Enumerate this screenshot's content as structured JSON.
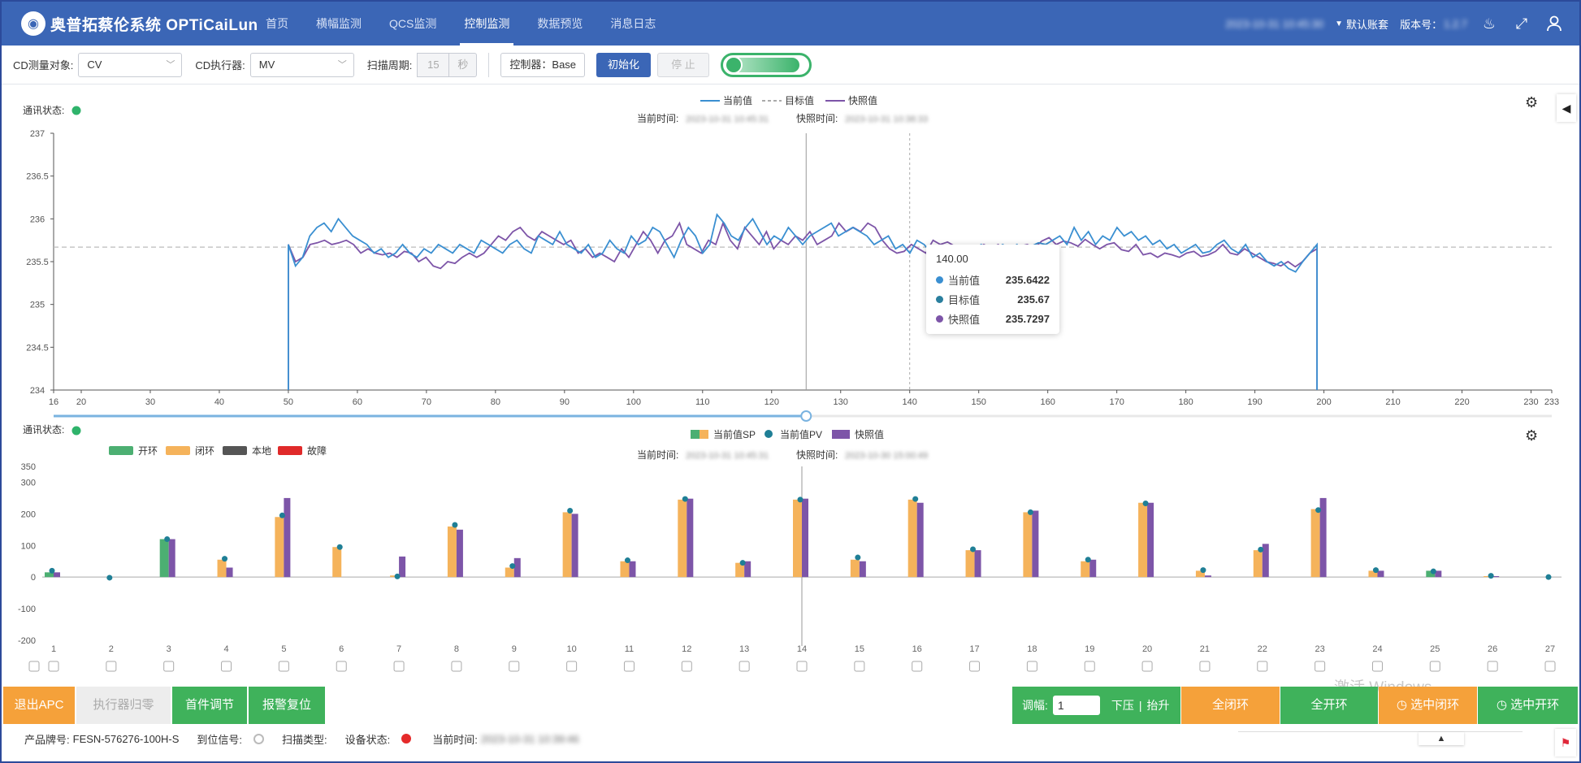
{
  "app": {
    "title": "奥普拓蔡伦系统 OPTiCaiLun",
    "nav": [
      "首页",
      "横幅监测",
      "QCS监测",
      "控制监测",
      "数据预览",
      "消息日志"
    ],
    "active_tab": "控制监测",
    "datetime": "2023-10-31 10:45:30",
    "account": "默认账套",
    "version_label": "版本号：",
    "version": "1.2.7"
  },
  "toolbar": {
    "cd_target_label": "CD测量对象:",
    "cd_target_value": "CV",
    "cd_actuator_label": "CD执行器:",
    "cd_actuator_value": "MV",
    "scan_period_label": "扫描周期:",
    "scan_period_value": "15",
    "scan_period_unit": "秒",
    "controller_text": "控制器：Base",
    "init_button": "初始化",
    "stop_button": "停 止"
  },
  "chart_top": {
    "comm_label": "通讯状态:",
    "comm_color": "#2fb36b",
    "legend": [
      "当前值",
      "目标值",
      "快照值"
    ],
    "current_time_label": "当前时间:",
    "current_time": "2023-10-31 10:45:31",
    "snapshot_time_label": "快照时间:",
    "snapshot_time": "2023-10-31 10:38:33",
    "tooltip": {
      "title": "140.00",
      "rows": [
        {
          "name": "当前值",
          "value": "235.6422",
          "color": "#3a8fd1"
        },
        {
          "name": "目标值",
          "value": "235.67",
          "color": "#2a7f9e"
        },
        {
          "name": "快照值",
          "value": "235.7297",
          "color": "#7d55a8"
        }
      ]
    }
  },
  "chart_bottom": {
    "comm_label": "通讯状态:",
    "status_legend": [
      {
        "name": "开环",
        "color": "#4caf72"
      },
      {
        "name": "闭环",
        "color": "#f5b35b"
      },
      {
        "name": "本地",
        "color": "#555555"
      },
      {
        "name": "故障",
        "color": "#e02a2a"
      }
    ],
    "legend": [
      "当前值SP",
      "当前值PV",
      "快照值"
    ],
    "current_time_label": "当前时间:",
    "current_time": "2023-10-31 10:45:31",
    "snapshot_time_label": "快照时间:",
    "snapshot_time": "2023-10-30 15:00:49"
  },
  "chart_data": [
    {
      "type": "line",
      "xlim": [
        16,
        233
      ],
      "x_ticks": [
        16,
        20,
        30,
        40,
        50,
        60,
        70,
        80,
        90,
        100,
        110,
        120,
        130,
        140,
        150,
        160,
        170,
        180,
        190,
        200,
        210,
        220,
        230,
        233
      ],
      "ylim": [
        234,
        237
      ],
      "y_ticks": [
        "234",
        "234.5",
        "235",
        "235.5",
        "236",
        "236.5",
        "237"
      ],
      "grid": false,
      "legend_position": "top-center",
      "target": 235.67,
      "cursor_x": 125,
      "snapshot_cursor_x": 140,
      "series": [
        {
          "name": "当前值",
          "color": "#3a8fd1",
          "x_start": 50,
          "x_end": 199,
          "values": [
            235.7,
            235.45,
            235.55,
            235.8,
            235.9,
            235.95,
            235.85,
            236.0,
            235.9,
            235.8,
            235.75,
            235.7,
            235.6,
            235.65,
            235.55,
            235.6,
            235.7,
            235.6,
            235.55,
            235.65,
            235.6,
            235.7,
            235.65,
            235.6,
            235.7,
            235.65,
            235.6,
            235.75,
            235.7,
            235.65,
            235.6,
            235.7,
            235.75,
            235.65,
            235.6,
            235.8,
            235.75,
            235.7,
            235.85,
            235.7,
            235.65,
            235.6,
            235.7,
            235.55,
            235.6,
            235.75,
            235.65,
            235.6,
            235.8,
            235.7,
            235.75,
            235.9,
            235.85,
            235.7,
            235.55,
            235.75,
            235.9,
            235.8,
            235.6,
            235.7,
            236.05,
            235.95,
            235.8,
            235.75,
            235.9,
            236.0,
            235.85,
            235.7,
            235.8,
            235.75,
            235.9,
            235.8,
            235.7,
            235.8,
            235.85,
            235.9,
            235.95,
            235.8,
            235.85,
            235.9,
            235.85,
            235.8,
            235.7,
            235.75,
            235.8,
            235.65,
            235.7,
            235.6,
            235.75,
            235.7,
            235.6,
            235.65,
            235.64,
            235.6,
            235.58,
            235.62,
            235.65,
            235.7,
            235.6,
            235.65,
            235.7,
            235.65,
            235.7,
            235.6,
            235.68,
            235.72,
            235.7,
            235.75,
            235.8,
            235.7,
            235.9,
            235.75,
            235.85,
            235.7,
            235.8,
            235.75,
            235.9,
            235.8,
            235.85,
            235.75,
            235.8,
            235.7,
            235.75,
            235.65,
            235.7,
            235.6,
            235.65,
            235.7,
            235.6,
            235.62,
            235.7,
            235.75,
            235.65,
            235.6,
            235.7,
            235.55,
            235.6,
            235.5,
            235.45,
            235.5,
            235.42,
            235.38,
            235.5,
            235.6,
            235.7
          ]
        },
        {
          "name": "快照值",
          "color": "#7d55a8",
          "x_start": 50,
          "x_end": 199,
          "values": [
            235.7,
            235.5,
            235.55,
            235.7,
            235.72,
            235.75,
            235.7,
            235.72,
            235.75,
            235.7,
            235.6,
            235.65,
            235.6,
            235.58,
            235.6,
            235.55,
            235.62,
            235.6,
            235.5,
            235.55,
            235.45,
            235.42,
            235.5,
            235.48,
            235.55,
            235.6,
            235.55,
            235.6,
            235.7,
            235.8,
            235.75,
            235.85,
            235.9,
            235.8,
            235.75,
            235.85,
            235.8,
            235.75,
            235.7,
            235.75,
            235.6,
            235.65,
            235.55,
            235.6,
            235.55,
            235.5,
            235.65,
            235.55,
            235.7,
            235.85,
            235.75,
            235.6,
            235.75,
            235.8,
            235.95,
            235.7,
            235.65,
            235.6,
            235.75,
            235.7,
            235.95,
            235.75,
            235.65,
            235.9,
            235.8,
            235.7,
            235.85,
            235.65,
            235.75,
            235.7,
            235.8,
            235.75,
            235.85,
            235.7,
            235.75,
            235.8,
            235.95,
            235.85,
            235.9,
            235.85,
            235.95,
            235.9,
            235.75,
            235.65,
            235.6,
            235.62,
            235.7,
            235.65,
            235.6,
            235.75,
            235.7,
            235.73,
            235.68,
            235.6,
            235.55,
            235.65,
            235.7,
            235.66,
            235.7,
            235.62,
            235.64,
            235.68,
            235.7,
            235.66,
            235.74,
            235.78,
            235.7,
            235.74,
            235.72,
            235.68,
            235.76,
            235.7,
            235.65,
            235.7,
            235.72,
            235.64,
            235.62,
            235.7,
            235.58,
            235.6,
            235.55,
            235.6,
            235.58,
            235.55,
            235.6,
            235.62,
            235.56,
            235.58,
            235.62,
            235.7,
            235.6,
            235.58,
            235.65,
            235.6,
            235.55,
            235.5,
            235.48,
            235.45,
            235.5,
            235.44,
            235.5,
            235.6,
            235.65
          ]
        }
      ]
    },
    {
      "type": "bar",
      "categories": [
        "1",
        "2",
        "3",
        "4",
        "5",
        "6",
        "7",
        "8",
        "9",
        "10",
        "11",
        "12",
        "13",
        "14",
        "15",
        "16",
        "17",
        "18",
        "19",
        "20",
        "21",
        "22",
        "23",
        "24",
        "25",
        "26",
        "27"
      ],
      "ylim": [
        -200,
        350
      ],
      "y_ticks": [
        "-200",
        "-100",
        "0",
        "100",
        "200",
        "300",
        "350"
      ],
      "cursor_category": "14",
      "series": [
        {
          "name": "当前值SP",
          "values": [
            15,
            0,
            120,
            55,
            190,
            95,
            5,
            160,
            30,
            205,
            50,
            245,
            45,
            245,
            55,
            245,
            85,
            205,
            50,
            235,
            20,
            85,
            215,
            20,
            20,
            3,
            0
          ],
          "status": [
            "开环",
            "闭环",
            "开环",
            "闭环",
            "闭环",
            "闭环",
            "闭环",
            "闭环",
            "闭环",
            "闭环",
            "闭环",
            "闭环",
            "闭环",
            "闭环",
            "闭环",
            "闭环",
            "闭环",
            "闭环",
            "闭环",
            "闭环",
            "闭环",
            "闭环",
            "闭环",
            "闭环",
            "开环",
            "闭环",
            "闭环"
          ]
        },
        {
          "name": "当前值PV",
          "values": [
            20,
            -2,
            120,
            58,
            195,
            95,
            2,
            165,
            35,
            210,
            53,
            247,
            45,
            245,
            62,
            247,
            88,
            205,
            55,
            233,
            22,
            87,
            212,
            22,
            18,
            4,
            0
          ]
        },
        {
          "name": "快照值",
          "values": [
            15,
            0,
            120,
            30,
            250,
            0,
            65,
            150,
            60,
            200,
            50,
            248,
            50,
            248,
            50,
            235,
            85,
            210,
            55,
            235,
            5,
            105,
            250,
            20,
            20,
            3,
            0
          ]
        }
      ]
    }
  ],
  "actions": {
    "exit_apc": "退出APC",
    "actuator_zero": "执行器归零",
    "first_adjust": "首件调节",
    "alarm_reset": "报警复位",
    "amp_label": "调幅:",
    "amp_value": "1",
    "press_down": "下压",
    "lift_up": "抬升",
    "all_close": "全闭环",
    "all_open": "全开环",
    "selected_close": "选中闭环",
    "selected_open": "选中开环",
    "colors": {
      "orange": "#f5a13a",
      "green": "#3fb25b",
      "disabled": "#ededed"
    }
  },
  "status": {
    "product_label": "产品牌号:",
    "product_value": "FESN-576276-100H-S",
    "position_label": "到位信号:",
    "scan_type_label": "扫描类型:",
    "device_label": "设备状态:",
    "time_label": "当前时间:",
    "time_value": "2023-10-31 10:39:46"
  },
  "watermark": "激活 Windows"
}
